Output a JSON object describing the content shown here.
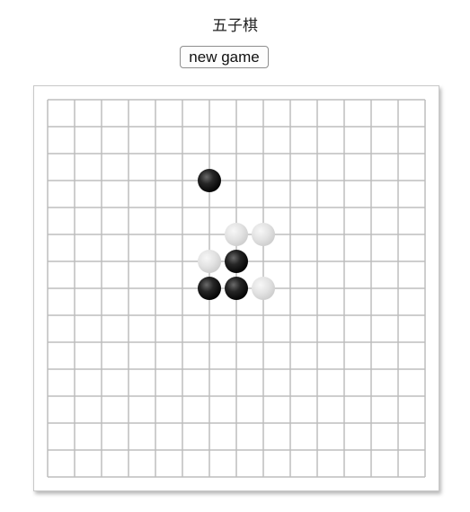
{
  "header": {
    "title": "五子棋"
  },
  "controls": {
    "new_game_label": "new game"
  },
  "board": {
    "lines": 15,
    "line_color": "#bdbdbd",
    "black_stone_color": "#1a1a1a",
    "white_stone_color": "#e0e0e0",
    "stones": [
      {
        "col": 6,
        "row": 3,
        "color": "black"
      },
      {
        "col": 7,
        "row": 5,
        "color": "white"
      },
      {
        "col": 8,
        "row": 5,
        "color": "white"
      },
      {
        "col": 6,
        "row": 6,
        "color": "white"
      },
      {
        "col": 7,
        "row": 6,
        "color": "black"
      },
      {
        "col": 6,
        "row": 7,
        "color": "black"
      },
      {
        "col": 7,
        "row": 7,
        "color": "black"
      },
      {
        "col": 8,
        "row": 7,
        "color": "white"
      }
    ]
  }
}
